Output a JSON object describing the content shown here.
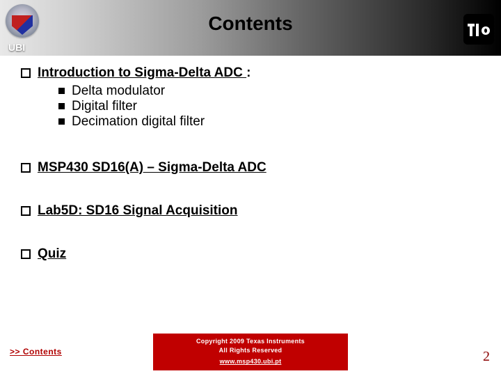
{
  "header": {
    "title": "Contents",
    "ubi_label": "UBI"
  },
  "toc": {
    "item1": {
      "label": "Introduction to Sigma-Delta ADC ",
      "suffix": ":"
    },
    "item1_subs": {
      "a": "Delta modulator",
      "b": "Digital filter",
      "c": "Decimation digital filter"
    },
    "item2": {
      "label": "MSP430 SD16(A) – Sigma-Delta ADC"
    },
    "item3": {
      "label": "Lab5D: SD16 Signal Acquisition"
    },
    "item4": {
      "label": "Quiz"
    }
  },
  "footer": {
    "contents_link": ">> Contents",
    "copyright_line1": "Copyright  2009 Texas Instruments",
    "copyright_line2": "All Rights Reserved",
    "url": "www.msp430.ubi.pt",
    "page_number": "2"
  }
}
